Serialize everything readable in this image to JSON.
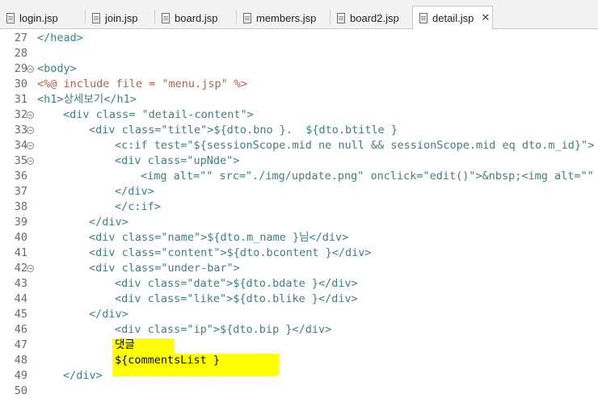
{
  "tabs": [
    {
      "label": "login.jsp"
    },
    {
      "label": "join.jsp"
    },
    {
      "label": "board.jsp"
    },
    {
      "label": "members.jsp"
    },
    {
      "label": "board2.jsp"
    },
    {
      "label": "detail.jsp"
    }
  ],
  "close_glyph": "✕",
  "lines": [
    {
      "n": "27",
      "t": "</head>"
    },
    {
      "n": "28",
      "t": ""
    },
    {
      "n": "29",
      "t": "<body>"
    },
    {
      "n": "30",
      "t": "<%@ include file = \"menu.jsp\" %>"
    },
    {
      "n": "31",
      "t": "<h1>상세보기</h1>"
    },
    {
      "n": "32",
      "t": "<div class= \"detail-content\">"
    },
    {
      "n": "33",
      "t": "<div class=\"title\">${dto.bno }.  ${dto.btitle }"
    },
    {
      "n": "34",
      "t": "<c:if test=\"${sessionScope.mid ne null && sessionScope.mid eq dto.m_id}\">"
    },
    {
      "n": "35",
      "t": "<div class=\"upNde\">"
    },
    {
      "n": "36",
      "t": "<img alt=\"\" src=\"./img/update.png\" onclick=\"edit()\">&nbsp;<img alt=\"\" s"
    },
    {
      "n": "37",
      "t": "</div>"
    },
    {
      "n": "38",
      "t": "</c:if>"
    },
    {
      "n": "39",
      "t": "</div>"
    },
    {
      "n": "40",
      "t": "<div class=\"name\">${dto.m_name }님</div>"
    },
    {
      "n": "41",
      "t": "<div class=\"content\">${dto.bcontent }</div>"
    },
    {
      "n": "42",
      "t": "<div class=\"under-bar\">"
    },
    {
      "n": "43",
      "t": "<div class=\"date\">${dto.bdate }</div>"
    },
    {
      "n": "44",
      "t": "<div class=\"like\">${dto.blike }</div>"
    },
    {
      "n": "45",
      "t": "</div>"
    },
    {
      "n": "46",
      "t": "<div class=\"ip\">${dto.bip }</div>"
    },
    {
      "n": "47",
      "t": "댓글"
    },
    {
      "n": "48",
      "t": "${commentsList }"
    },
    {
      "n": "49",
      "t": "</div>"
    },
    {
      "n": "50",
      "t": ""
    }
  ]
}
